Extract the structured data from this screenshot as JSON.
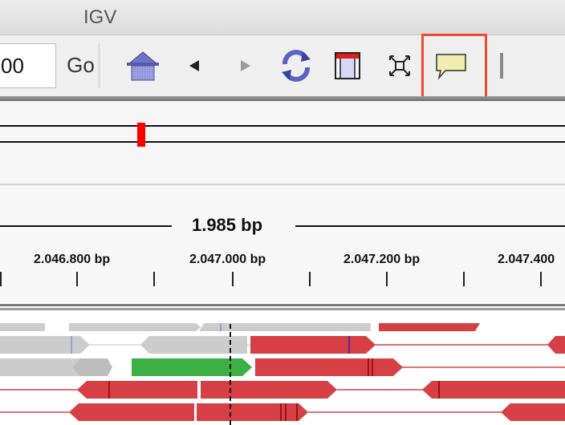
{
  "window": {
    "title": "IGV"
  },
  "toolbar": {
    "locus_value": "00",
    "go_label": "Go",
    "icons": [
      "home-icon",
      "back-arrow-icon",
      "forward-arrow-icon",
      "refresh-icon",
      "region-of-interest-icon",
      "resize-to-window-icon",
      "popup-text-behavior-icon"
    ]
  },
  "ruler": {
    "span_label": "1.985 bp",
    "ticks": [
      "2.046.800 bp",
      "2.047.000 bp",
      "2.047.200 bp",
      "2.047.400"
    ]
  },
  "colors": {
    "read_forward": "#d64045",
    "read_low_mapq": "#cccccc",
    "read_highlight": "#3cb043",
    "chromosome_marker": "#ff0000",
    "highlight_box": "#f04a2a"
  }
}
